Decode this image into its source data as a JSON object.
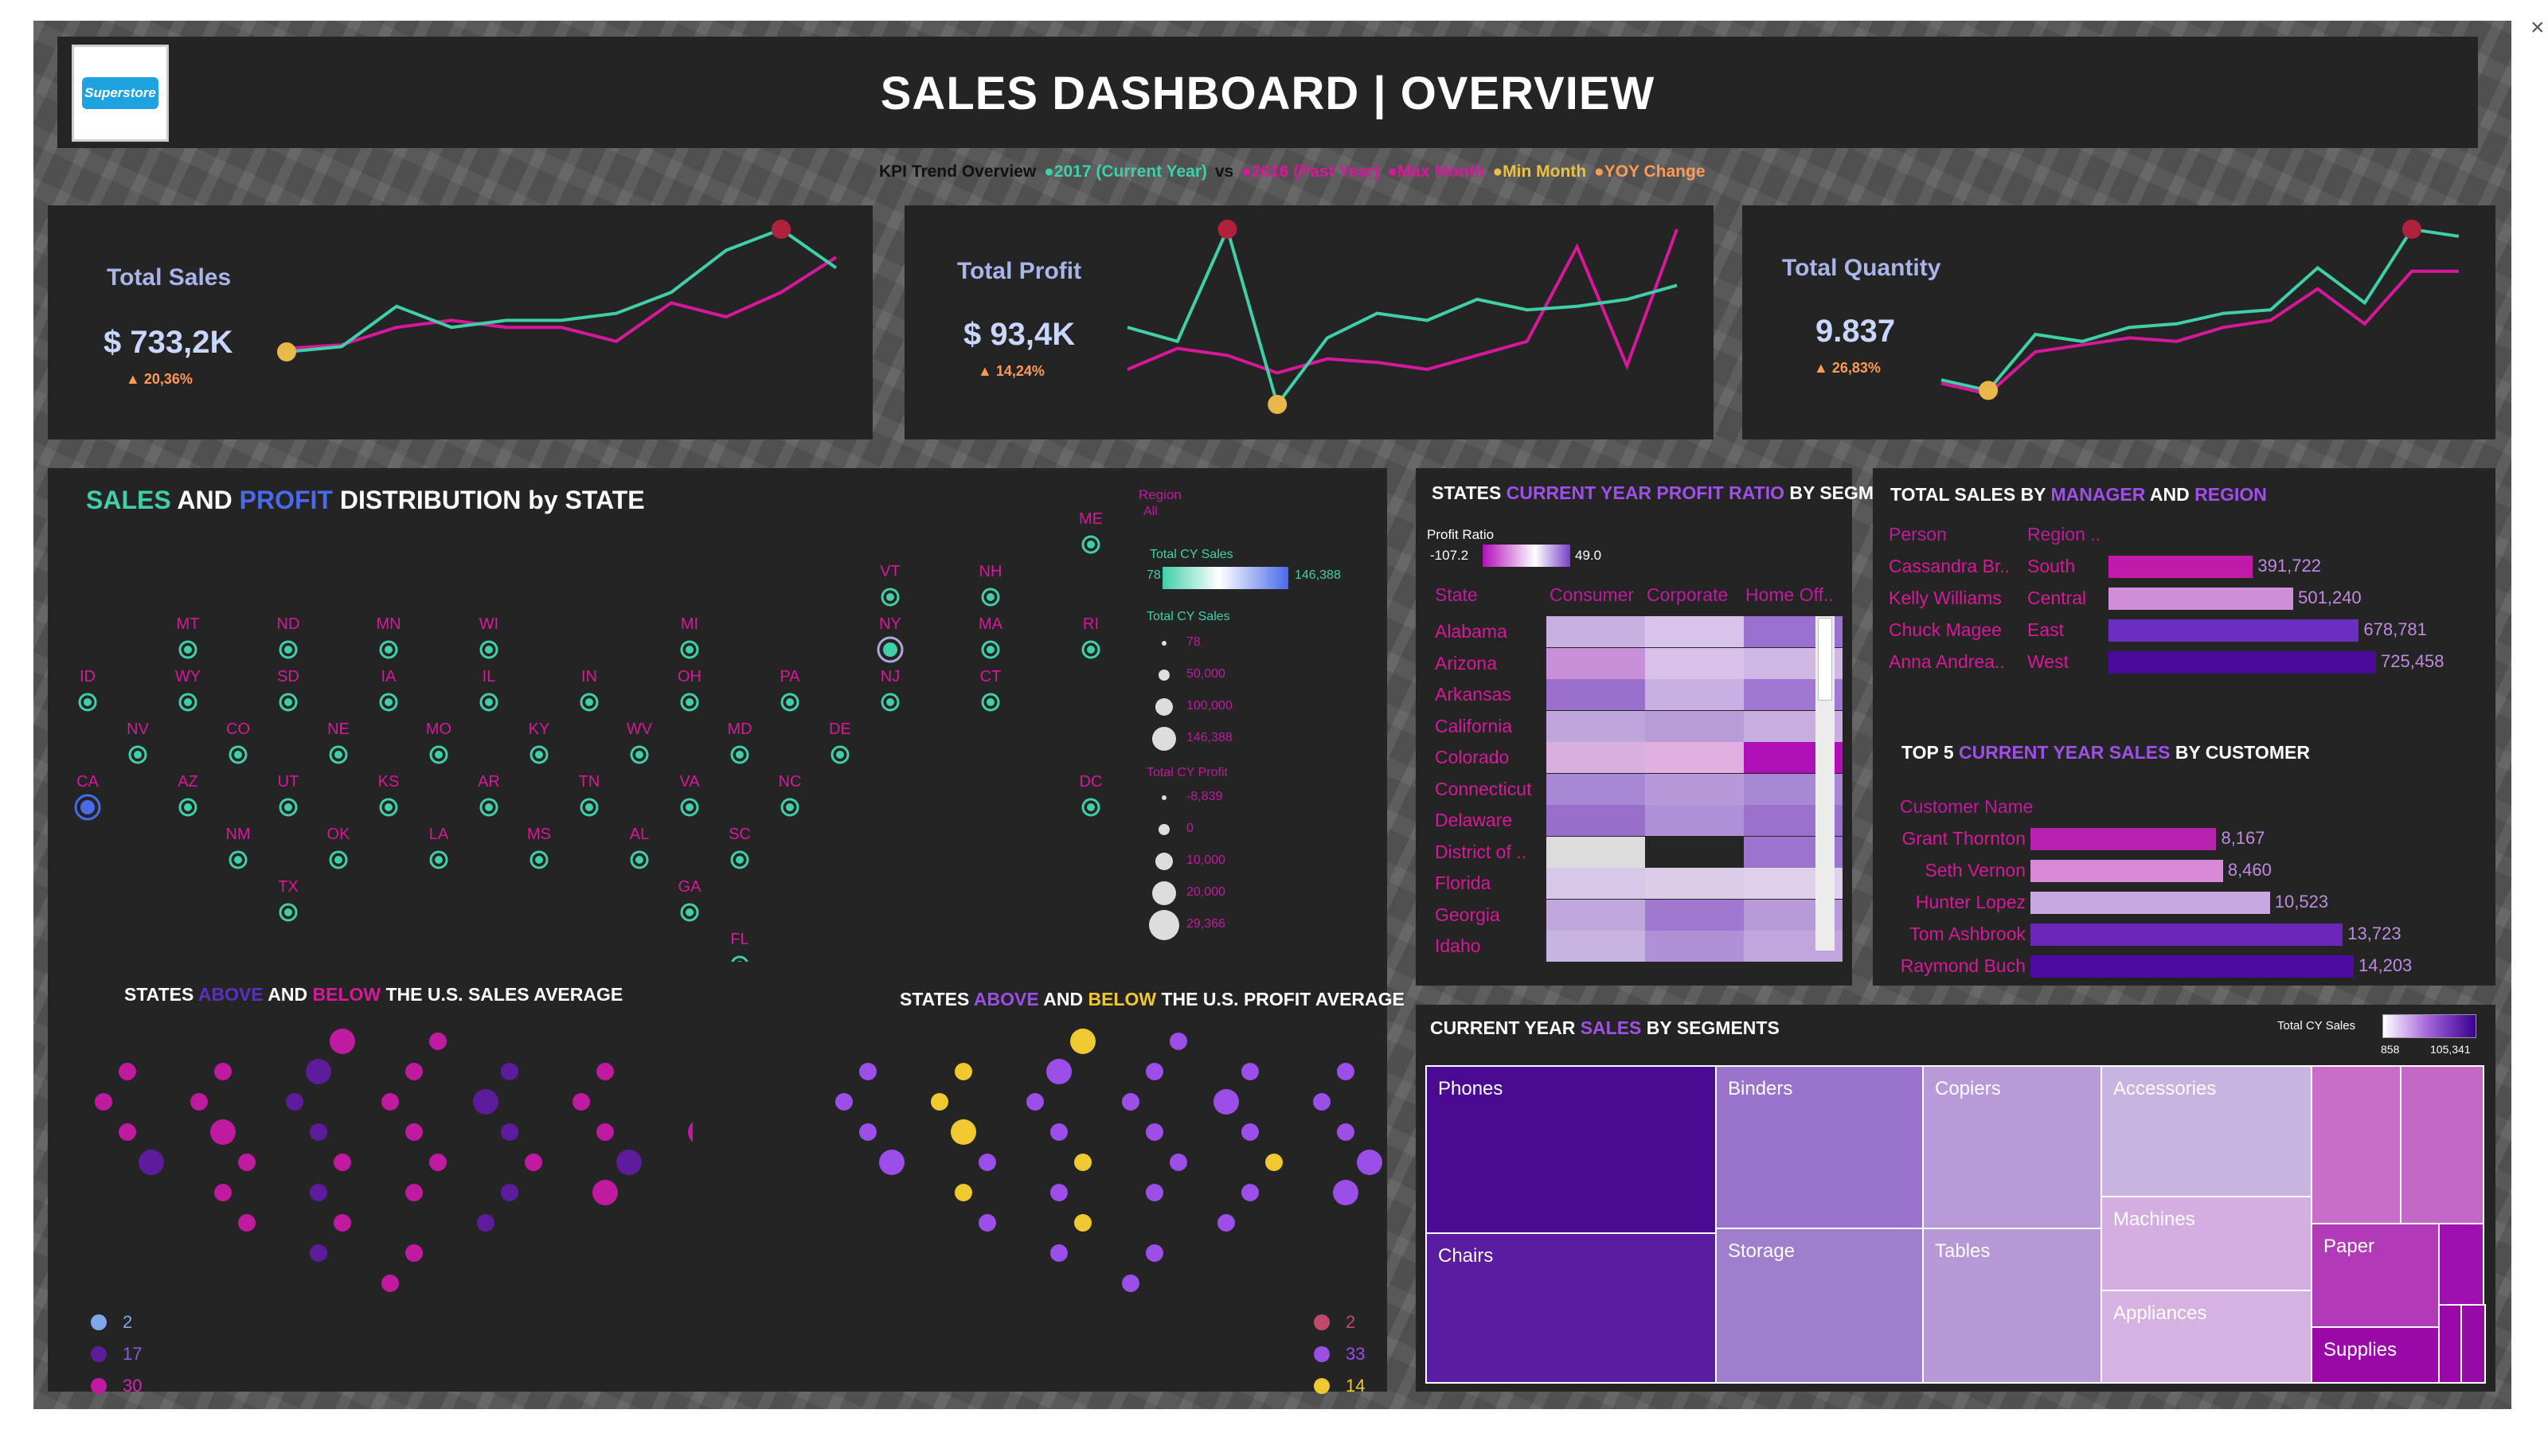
{
  "window": {
    "close_glyph": "×"
  },
  "header": {
    "logo_text": "Superstore",
    "title": "SALES DASHBOARD | OVERVIEW"
  },
  "kpi_legend": {
    "prefix": "KPI Trend Overview",
    "current": "●2017 (Current Year)",
    "vs": "vs",
    "past": "●2016 (Past Year)",
    "max": "●Max Month",
    "min": "●Min Month",
    "yoy": "●YOY Change"
  },
  "colors": {
    "current_year": "#3fcfa9",
    "past_year": "#d8189a",
    "max_month": "#b0223c",
    "min_month": "#e8b84a",
    "yoy": "#ff9a55",
    "panel": "#242424"
  },
  "kpis": [
    {
      "title": "Total Sales",
      "value": "$ 733,2K",
      "change": "▲ 20,36%",
      "cy": [
        30,
        33,
        56,
        44,
        48,
        48,
        52,
        64,
        88,
        100,
        78
      ],
      "py": [
        32,
        34,
        44,
        48,
        44,
        44,
        36,
        58,
        50,
        64,
        84
      ]
    },
    {
      "title": "Total Profit",
      "value": "$ 93,4K",
      "change": "▲ 14,24%",
      "cy": [
        44,
        36,
        100,
        0,
        38,
        52,
        48,
        60,
        54,
        56,
        60,
        68
      ],
      "py": [
        20,
        32,
        28,
        18,
        26,
        24,
        20,
        28,
        36,
        90,
        22,
        100
      ]
    },
    {
      "title": "Total Quantity",
      "value": "9.837",
      "change": "▲ 26,83%",
      "cy": [
        14,
        8,
        40,
        36,
        44,
        46,
        52,
        54,
        78,
        58,
        100,
        96
      ],
      "py": [
        12,
        6,
        30,
        34,
        38,
        36,
        44,
        48,
        66,
        46,
        76,
        76
      ]
    }
  ],
  "map_section": {
    "title_sales": "SALES",
    "title_and": "AND",
    "title_profit": "PROFIT",
    "title_rest": "DISTRIBUTION by STATE",
    "region_label": "Region",
    "region_value": "All",
    "legend_sales_title": "Total CY Sales",
    "legend_sales_min": "78",
    "legend_sales_max": "146,388",
    "legend_size_title": "Total CY Sales",
    "legend_size_values": [
      "78",
      "50,000",
      "100,000",
      "146,388"
    ],
    "legend_profit_title": "Total CY Profit",
    "legend_profit_values": [
      "-8,839",
      "0",
      "10,000",
      "20,000",
      "29,366"
    ],
    "states": [
      {
        "code": "ME",
        "c": 10,
        "r": 0
      },
      {
        "code": "VT",
        "c": 8,
        "r": 1
      },
      {
        "code": "NH",
        "c": 9,
        "r": 1
      },
      {
        "code": "MT",
        "c": 1,
        "r": 2
      },
      {
        "code": "ND",
        "c": 2,
        "r": 2
      },
      {
        "code": "MN",
        "c": 3,
        "r": 2
      },
      {
        "code": "WI",
        "c": 4,
        "r": 2
      },
      {
        "code": "MI",
        "c": 6,
        "r": 2
      },
      {
        "code": "NY",
        "c": 8,
        "r": 2
      },
      {
        "code": "MA",
        "c": 9,
        "r": 2
      },
      {
        "code": "RI",
        "c": 10,
        "r": 2
      },
      {
        "code": "ID",
        "c": 0,
        "r": 3
      },
      {
        "code": "WY",
        "c": 1,
        "r": 3
      },
      {
        "code": "SD",
        "c": 2,
        "r": 3
      },
      {
        "code": "IA",
        "c": 3,
        "r": 3
      },
      {
        "code": "IL",
        "c": 4,
        "r": 3
      },
      {
        "code": "IN",
        "c": 5,
        "r": 3
      },
      {
        "code": "OH",
        "c": 6,
        "r": 3
      },
      {
        "code": "PA",
        "c": 7,
        "r": 3
      },
      {
        "code": "NJ",
        "c": 8,
        "r": 3
      },
      {
        "code": "CT",
        "c": 9,
        "r": 3
      },
      {
        "code": "NV",
        "c": 0.5,
        "r": 4
      },
      {
        "code": "CO",
        "c": 1.5,
        "r": 4
      },
      {
        "code": "NE",
        "c": 2.5,
        "r": 4
      },
      {
        "code": "MO",
        "c": 3.5,
        "r": 4
      },
      {
        "code": "KY",
        "c": 4.5,
        "r": 4
      },
      {
        "code": "WV",
        "c": 5.5,
        "r": 4
      },
      {
        "code": "MD",
        "c": 6.5,
        "r": 4
      },
      {
        "code": "DE",
        "c": 7.5,
        "r": 4
      },
      {
        "code": "CA",
        "c": 0,
        "r": 5
      },
      {
        "code": "AZ",
        "c": 1,
        "r": 5
      },
      {
        "code": "UT",
        "c": 2,
        "r": 5
      },
      {
        "code": "KS",
        "c": 3,
        "r": 5
      },
      {
        "code": "AR",
        "c": 4,
        "r": 5
      },
      {
        "code": "TN",
        "c": 5,
        "r": 5
      },
      {
        "code": "VA",
        "c": 6,
        "r": 5
      },
      {
        "code": "NC",
        "c": 7,
        "r": 5
      },
      {
        "code": "DC",
        "c": 10,
        "r": 5
      },
      {
        "code": "NM",
        "c": 1.5,
        "r": 6
      },
      {
        "code": "OK",
        "c": 2.5,
        "r": 6
      },
      {
        "code": "LA",
        "c": 3.5,
        "r": 6
      },
      {
        "code": "MS",
        "c": 4.5,
        "r": 6
      },
      {
        "code": "AL",
        "c": 5.5,
        "r": 6
      },
      {
        "code": "SC",
        "c": 6.5,
        "r": 6
      },
      {
        "code": "TX",
        "c": 2,
        "r": 7
      },
      {
        "code": "GA",
        "c": 6,
        "r": 7
      },
      {
        "code": "FL",
        "c": 6.5,
        "r": 8
      }
    ]
  },
  "sales_avg": {
    "title_pre": "STATES",
    "title_above": "ABOVE",
    "title_and": "AND",
    "title_below": "BELOW",
    "title_post": "THE U.S. SALES AVERAGE",
    "legend": [
      {
        "color": "#7fa8e8",
        "count": "2"
      },
      {
        "color": "#5c1c9c",
        "count": "17"
      },
      {
        "color": "#c01aa0",
        "count": "30"
      }
    ]
  },
  "profit_avg": {
    "title_pre": "STATES",
    "title_above": "ABOVE",
    "title_and": "AND",
    "title_below": "BELOW",
    "title_post": "THE U.S. PROFIT AVERAGE",
    "legend": [
      {
        "color": "#c04a6a",
        "count": "2"
      },
      {
        "color": "#9b4ee8",
        "count": "33"
      },
      {
        "color": "#f0c830",
        "count": "14"
      }
    ]
  },
  "profit_ratio": {
    "title_pre": "STATES",
    "title_hl": "CURRENT YEAR PROFIT RATIO",
    "title_post": "BY SEGMENTS",
    "legend_title": "Profit Ratio",
    "legend_min": "-107.2",
    "legend_max": "49.0",
    "col_header": "State",
    "segments": [
      "Consumer",
      "Corporate",
      "Home Off.."
    ],
    "rows": [
      {
        "state": "Alabama",
        "cells": [
          "#c8b0e0",
          "#d8c4ea",
          "#9a70d0"
        ]
      },
      {
        "state": "Arizona",
        "cells": [
          "#c890d8",
          "#d8c0e8",
          "#d0b8e6"
        ]
      },
      {
        "state": "Arkansas",
        "cells": [
          "#9a70cc",
          "#c8b0e2",
          "#a078d2"
        ]
      },
      {
        "state": "California",
        "cells": [
          "#c0a4dc",
          "#b89cd8",
          "#c8aee0"
        ]
      },
      {
        "state": "Colorado",
        "cells": [
          "#d8b0e0",
          "#e0b0e0",
          "#b010b8"
        ]
      },
      {
        "state": "Connecticut",
        "cells": [
          "#a888d4",
          "#b898d8",
          "#a888d2"
        ]
      },
      {
        "state": "Delaware",
        "cells": [
          "#9870cc",
          "#b090d6",
          "#9a72ce"
        ]
      },
      {
        "state": "District of ..",
        "cells": [
          "#dcdcdc",
          "#262626",
          "#9c74d0"
        ]
      },
      {
        "state": "Florida",
        "cells": [
          "#d8c8e8",
          "#dccce8",
          "#dcd0ea"
        ]
      },
      {
        "state": "Georgia",
        "cells": [
          "#c0a8dc",
          "#a078d0",
          "#b89ad8"
        ]
      },
      {
        "state": "Idaho",
        "cells": [
          "#c8b4e0",
          "#b090d6",
          "#c0a6dc"
        ]
      }
    ]
  },
  "sales_manager": {
    "title_pre": "TOTAL SALES BY",
    "title_hl1": "MANAGER",
    "title_and": "AND",
    "title_hl2": "REGION",
    "col_person": "Person",
    "col_region": "Region ..",
    "rows": [
      {
        "person": "Cassandra Br..",
        "region": "South",
        "value": 391722,
        "label": "391,722",
        "color": "#c21aa8"
      },
      {
        "person": "Kelly Williams",
        "region": "Central",
        "value": 501240,
        "label": "501,240",
        "color": "#d08ed8"
      },
      {
        "person": "Chuck Magee",
        "region": "East",
        "value": 678781,
        "label": "678,781",
        "color": "#6a2ec0"
      },
      {
        "person": "Anna Andrea..",
        "region": "West",
        "value": 725458,
        "label": "725,458",
        "color": "#4a0a9a"
      }
    ]
  },
  "top_customers": {
    "title_pre": "TOP 5",
    "title_hl": "CURRENT YEAR SALES",
    "title_post": "BY CUSTOMER",
    "col_header": "Customer Name",
    "rows": [
      {
        "name": "Grant Thornton",
        "value": 8167,
        "label": "8,167",
        "color": "#b822b0"
      },
      {
        "name": "Seth Vernon",
        "value": 8460,
        "label": "8,460",
        "color": "#d88ad8"
      },
      {
        "name": "Hunter Lopez",
        "value": 10523,
        "label": "10,523",
        "color": "#c8a8e0"
      },
      {
        "name": "Tom Ashbrook",
        "value": 13723,
        "label": "13,723",
        "color": "#6a26b8"
      },
      {
        "name": "Raymond Buch",
        "value": 14203,
        "label": "14,203",
        "color": "#4c0a9e"
      }
    ]
  },
  "segments_tree": {
    "title_pre": "CURRENT YEAR",
    "title_hl": "SALES",
    "title_post": "BY SEGMENTS",
    "legend_title": "Total CY Sales",
    "legend_min": "858",
    "legend_max": "105,341",
    "tiles": {
      "phones": "Phones",
      "chairs": "Chairs",
      "binders": "Binders",
      "storage": "Storage",
      "copiers": "Copiers",
      "tables": "Tables",
      "accessories": "Accessories",
      "machines": "Machines",
      "appliances": "Appliances",
      "paper": "Paper",
      "supplies": "Supplies"
    }
  }
}
